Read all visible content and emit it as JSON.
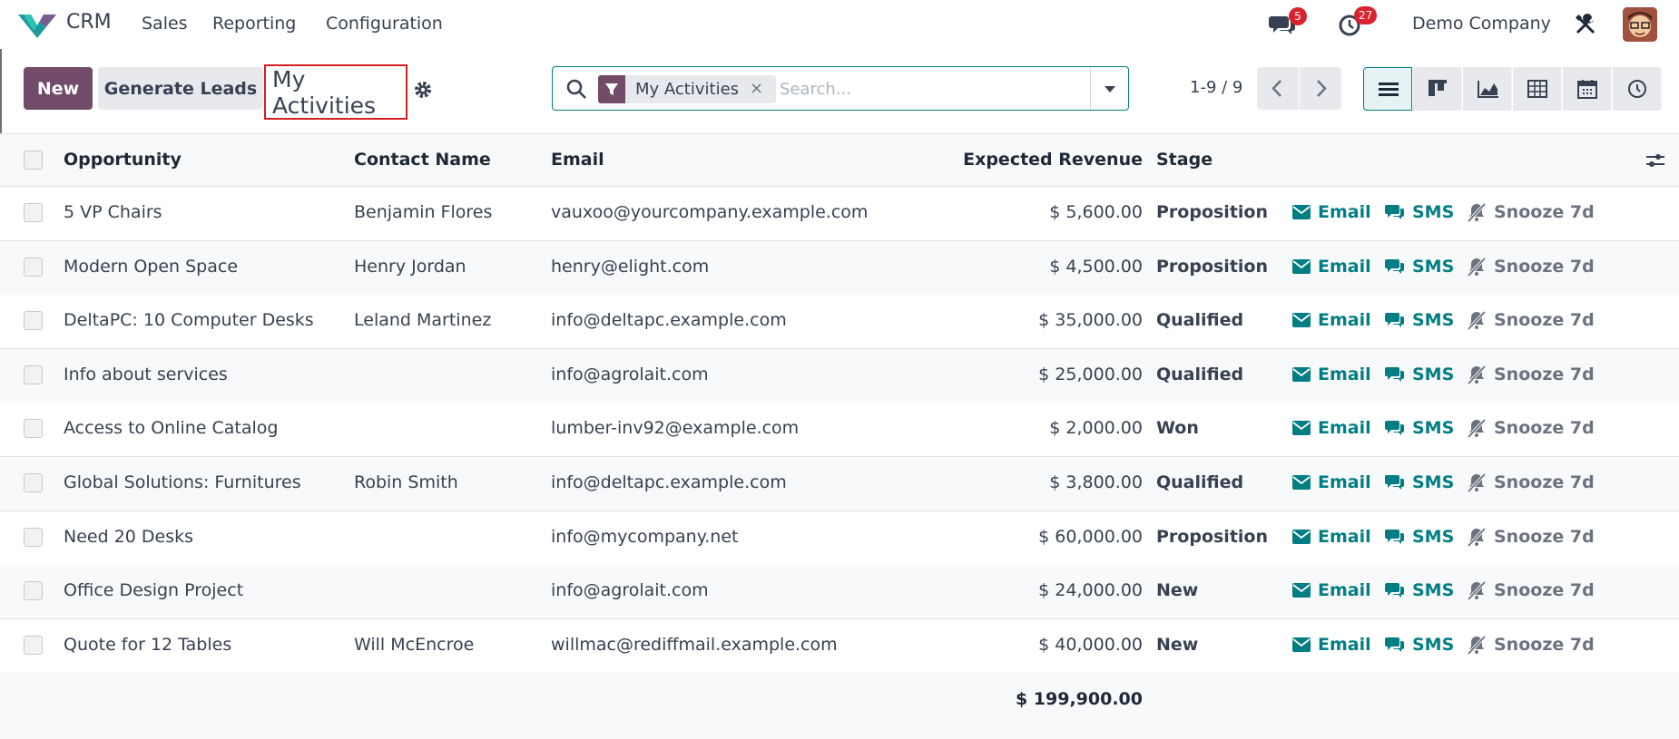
{
  "navbar": {
    "app_name": "CRM",
    "menu": [
      "Sales",
      "Reporting",
      "Configuration"
    ],
    "messages_count": "5",
    "activities_count": "27",
    "company": "Demo Company",
    "icons": {
      "messages": "chat-icon",
      "activities": "clock-icon",
      "debug": "tools-icon"
    }
  },
  "control_panel": {
    "new_label": "New",
    "generate_label": "Generate Leads",
    "title": "My Activities",
    "search": {
      "facet": "My Activities",
      "placeholder": "Search..."
    },
    "pager": "1-9 / 9",
    "views": [
      "list",
      "kanban",
      "graph",
      "pivot",
      "calendar",
      "activity"
    ],
    "active_view": "list"
  },
  "table": {
    "columns": [
      "Opportunity",
      "Contact Name",
      "Email",
      "Expected Revenue",
      "Stage"
    ],
    "action_labels": {
      "email": "Email",
      "sms": "SMS",
      "snooze": "Snooze 7d"
    },
    "rows": [
      {
        "opportunity": "5 VP Chairs",
        "contact": "Benjamin Flores",
        "email": "vauxoo@yourcompany.example.com",
        "revenue": "$ 5,600.00",
        "stage": "Proposition"
      },
      {
        "opportunity": "Modern Open Space",
        "contact": "Henry Jordan",
        "email": "henry@elight.com",
        "revenue": "$ 4,500.00",
        "stage": "Proposition"
      },
      {
        "opportunity": "DeltaPC: 10 Computer Desks",
        "contact": "Leland Martinez",
        "email": "info@deltapc.example.com",
        "revenue": "$ 35,000.00",
        "stage": "Qualified"
      },
      {
        "opportunity": "Info about services",
        "contact": "",
        "email": "info@agrolait.com",
        "revenue": "$ 25,000.00",
        "stage": "Qualified"
      },
      {
        "opportunity": "Access to Online Catalog",
        "contact": "",
        "email": "lumber-inv92@example.com",
        "revenue": "$ 2,000.00",
        "stage": "Won"
      },
      {
        "opportunity": "Global Solutions: Furnitures",
        "contact": "Robin Smith",
        "email": "info@deltapc.example.com",
        "revenue": "$ 3,800.00",
        "stage": "Qualified"
      },
      {
        "opportunity": "Need 20 Desks",
        "contact": "",
        "email": "info@mycompany.net",
        "revenue": "$ 60,000.00",
        "stage": "Proposition"
      },
      {
        "opportunity": "Office Design Project",
        "contact": "",
        "email": "info@agrolait.com",
        "revenue": "$ 24,000.00",
        "stage": "New"
      },
      {
        "opportunity": "Quote for 12 Tables",
        "contact": "Will McEncroe",
        "email": "willmac@rediffmail.example.com",
        "revenue": "$ 40,000.00",
        "stage": "New"
      }
    ],
    "total": "$ 199,900.00"
  },
  "colors": {
    "brand": "#714b67",
    "accent": "#017e84",
    "badge": "#d9232e",
    "highlight_border": "#d21f1f"
  }
}
